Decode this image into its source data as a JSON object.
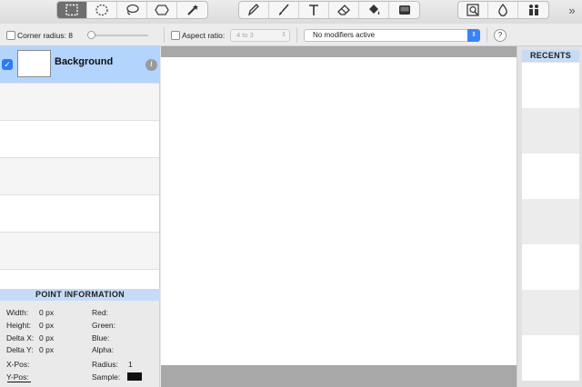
{
  "toolbar": {
    "groups": [
      [
        "rect-select-icon",
        "ellipse-select-icon",
        "lasso-icon",
        "polygon-select-icon",
        "magic-wand-icon"
      ],
      [
        "pen-icon",
        "brush-icon",
        "text-icon",
        "eraser-icon",
        "paint-bucket-icon",
        "rectangle-shape-icon"
      ],
      [
        "zoom-region-icon",
        "drop-icon",
        "people-icon"
      ]
    ],
    "overflow": "»"
  },
  "options": {
    "corner_radius_label": "Corner radius: 8",
    "aspect_ratio_label": "Aspect ratio:",
    "aspect_ratio_value": "4 to 3",
    "modifiers_value": "No modifiers active",
    "help": "?"
  },
  "layers": {
    "items": [
      {
        "name": "Background",
        "checked": true
      }
    ],
    "check_glyph": "✓",
    "info_glyph": "i"
  },
  "point_info": {
    "title": "POINT INFORMATION",
    "width": "Width:",
    "width_val": "0 px",
    "height": "Height:",
    "height_val": "0 px",
    "delta_x": "Delta X:",
    "delta_x_val": "0 px",
    "delta_y": "Delta Y:",
    "delta_y_val": "0 px",
    "x_pos": "X-Pos:",
    "y_pos": "Y-Pos:",
    "red": "Red:",
    "green": "Green:",
    "blue": "Blue:",
    "alpha": "Alpha:",
    "radius": "Radius:",
    "radius_val": "1",
    "sample": "Sample:"
  },
  "recents": {
    "title": "RECENTS"
  },
  "colors": {
    "accent": "#2f7bf5",
    "selection": "#b3d4fc",
    "header": "#c6dcf6"
  }
}
